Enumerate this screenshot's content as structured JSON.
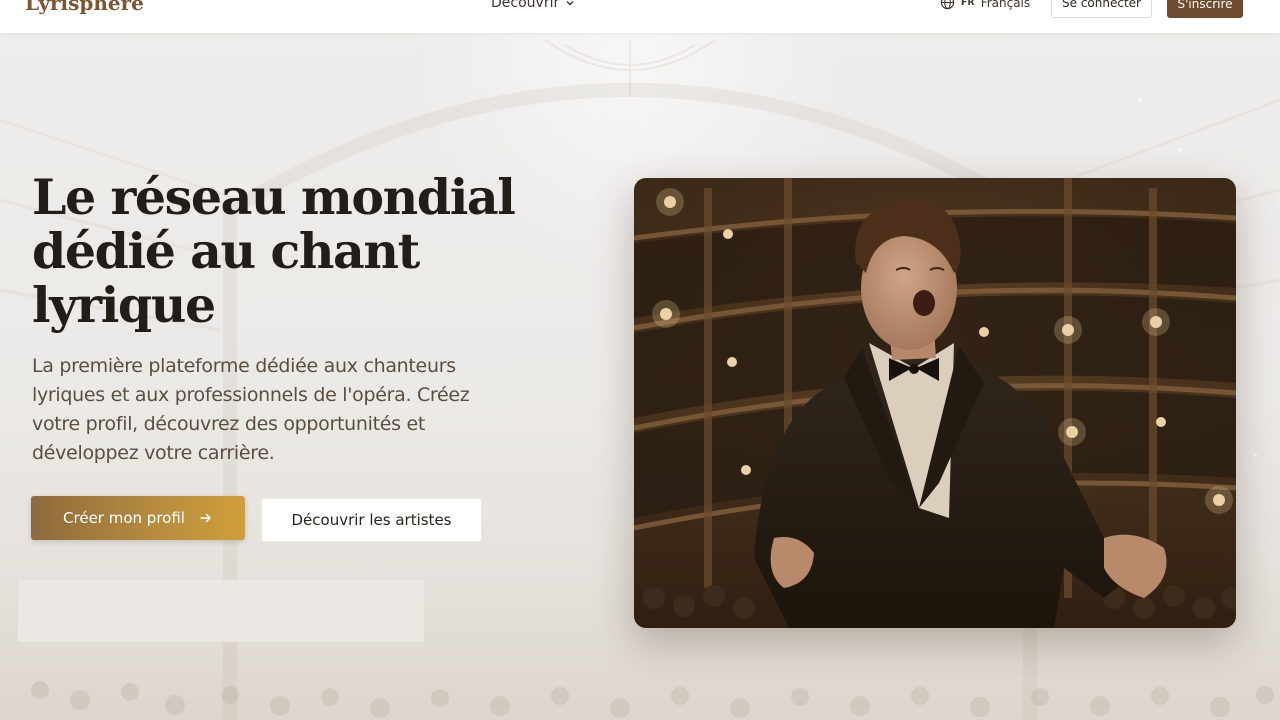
{
  "header": {
    "logo": "Lyrisphère",
    "nav_discover": "Découvrir",
    "lang_code": "FR",
    "lang_name": "Français",
    "login": "Se connecter",
    "signup": "S'inscrire"
  },
  "hero": {
    "title": "Le réseau mondial dédié au chant lyrique",
    "subtitle": "La première plateforme dédiée aux chanteurs lyriques et aux professionnels de l'opéra. Créez votre profil, découvrez des opportunités et développez votre carrière.",
    "cta_primary": "Créer mon profil",
    "cta_secondary": "Découvrir les artistes",
    "image_alt": "Young opera singer in a tuxedo performing on stage in an opera house"
  },
  "icons": {
    "chevron": "chevron-down-icon",
    "globe": "globe-icon",
    "arrow": "arrow-right-icon"
  },
  "colors": {
    "brand": "#7a5632",
    "signup_bg": "#6e4a2e",
    "cta_gradient_start": "#8e6a3d",
    "cta_gradient_end": "#cf9f3b"
  }
}
